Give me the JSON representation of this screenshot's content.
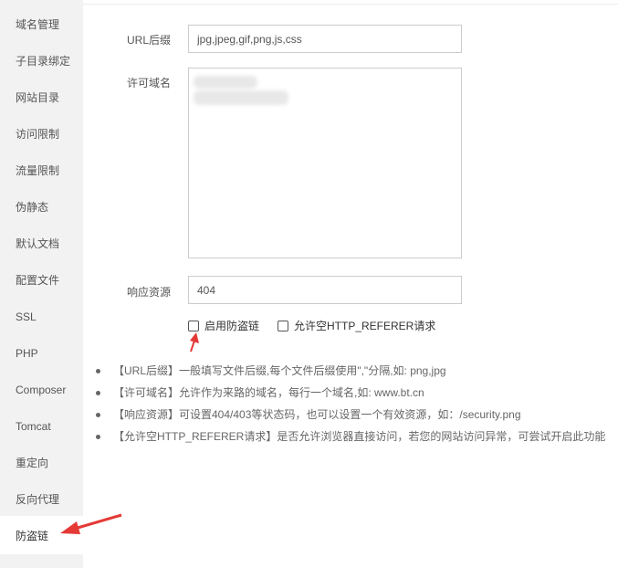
{
  "sidebar": {
    "items": [
      {
        "label": "域名管理"
      },
      {
        "label": "子目录绑定"
      },
      {
        "label": "网站目录"
      },
      {
        "label": "访问限制"
      },
      {
        "label": "流量限制"
      },
      {
        "label": "伪静态"
      },
      {
        "label": "默认文档"
      },
      {
        "label": "配置文件"
      },
      {
        "label": "SSL"
      },
      {
        "label": "PHP"
      },
      {
        "label": "Composer"
      },
      {
        "label": "Tomcat"
      },
      {
        "label": "重定向"
      },
      {
        "label": "反向代理"
      },
      {
        "label": "防盗链"
      }
    ],
    "active": "防盗链"
  },
  "form": {
    "url_suffix_label": "URL后缀",
    "url_suffix_value": "jpg,jpeg,gif,png,js,css",
    "allowed_domains_label": "许可域名",
    "response_label": "响应资源",
    "response_value": "404",
    "enable_label": "启用防盗链",
    "allow_empty_label": "允许空HTTP_REFERER请求"
  },
  "tips": [
    "【URL后缀】一般填写文件后缀,每个文件后缀使用\",\"分隔,如: png,jpg",
    "【许可域名】允许作为来路的域名，每行一个域名,如: www.bt.cn",
    "【响应资源】可设置404/403等状态码，也可以设置一个有效资源，如：/security.png",
    "【允许空HTTP_REFERER请求】是否允许浏览器直接访问，若您的网站访问异常，可尝试开启此功能"
  ],
  "colors": {
    "sidebar_bg": "#f2f2f2",
    "annotation_arrow": "#e53935"
  }
}
